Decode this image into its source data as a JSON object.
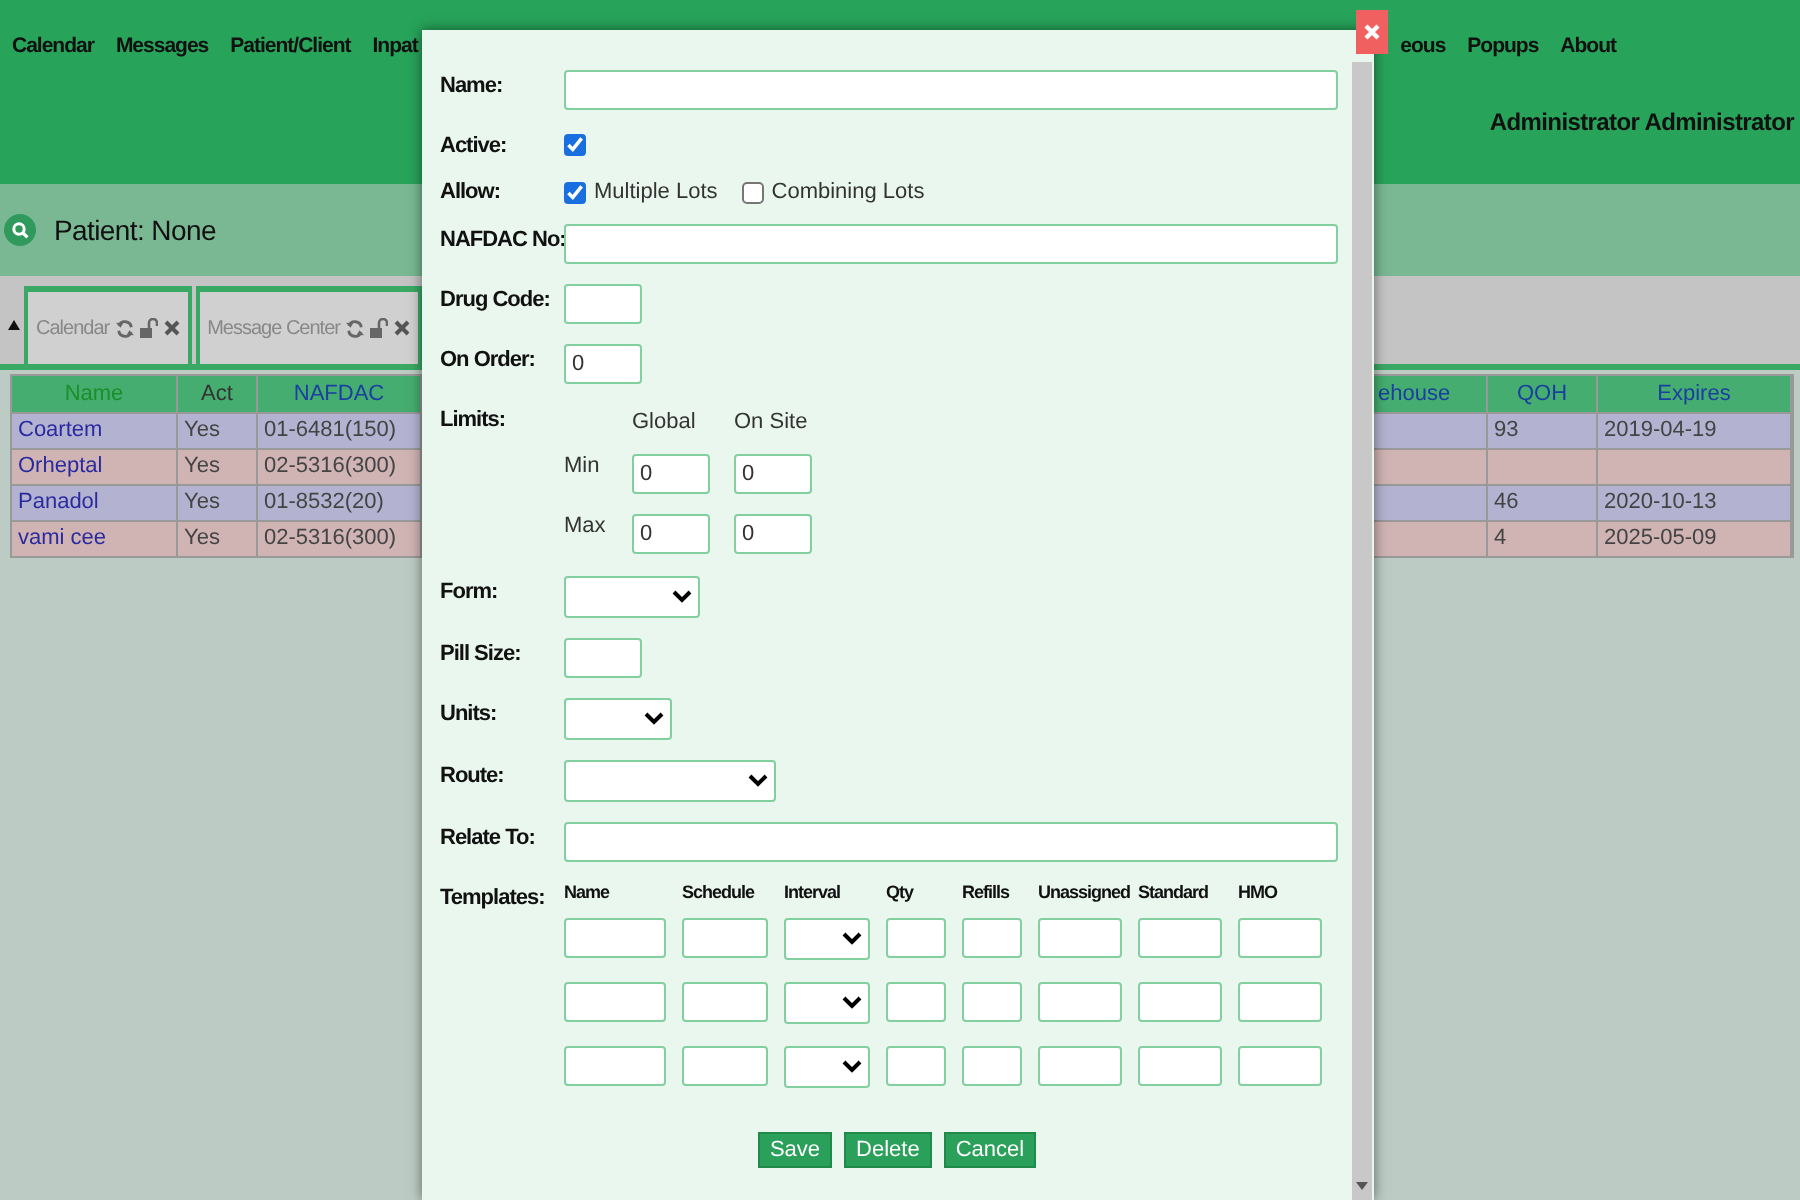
{
  "nav": {
    "left": [
      "Calendar",
      "Messages",
      "Patient/Client",
      "Inpat"
    ],
    "right": [
      "eous",
      "Popups",
      "About"
    ],
    "user": "Administrator Administrator"
  },
  "patient": "Patient: None",
  "tabs": [
    {
      "label": "Calendar"
    },
    {
      "label": "Message Center"
    }
  ],
  "table": {
    "columns": [
      "Name",
      "Act",
      "NAFDAC",
      "ehouse",
      "QOH",
      "Expires"
    ],
    "rows": [
      {
        "name": "Coartem",
        "act": "Yes",
        "nafdac": "01-6481(150)",
        "qoh": "93",
        "expires": "2019-04-19",
        "color": "#b3b3d1"
      },
      {
        "name": "Orheptal",
        "act": "Yes",
        "nafdac": "02-5316(300)",
        "color": "#d0b3b3"
      },
      {
        "name": "Panadol",
        "act": "Yes",
        "nafdac": "01-8532(20)",
        "qoh": "46",
        "expires": "2020-10-13",
        "color": "#b3b3d1"
      },
      {
        "name": "vami cee",
        "act": "Yes",
        "nafdac": "02-5316(300)",
        "qoh": "4",
        "expires": "2025-05-09",
        "color": "#d0b3b3"
      }
    ]
  },
  "modal": {
    "fields": [
      {
        "kind": "text",
        "label": "Name:"
      },
      {
        "kind": "checkbox",
        "label": "Active:",
        "checked": true
      },
      {
        "kind": "options",
        "label": "Allow:",
        "options": [
          {
            "label": "Multiple Lots",
            "checked": true
          },
          {
            "label": "Combining Lots",
            "checked": false
          }
        ]
      },
      {
        "kind": "text",
        "label": "NAFDAC No:"
      },
      {
        "kind": "text",
        "label": "Drug Code:"
      },
      {
        "kind": "text",
        "label": "On Order:",
        "value": "0"
      },
      {
        "kind": "limits",
        "label": "Limits:",
        "columns": [
          "Global",
          "On Site"
        ],
        "rows": [
          {
            "label": "Min",
            "values": [
              "0",
              "0"
            ]
          },
          {
            "label": "Max",
            "values": [
              "0",
              "0"
            ]
          }
        ]
      },
      {
        "kind": "select",
        "label": "Form:"
      },
      {
        "kind": "text",
        "label": "Pill Size:"
      },
      {
        "kind": "select",
        "label": "Units:"
      },
      {
        "kind": "select",
        "label": "Route:"
      },
      {
        "kind": "text",
        "label": "Relate To:"
      }
    ],
    "templates": {
      "label": "Templates:",
      "columns": [
        {
          "label": "Name",
          "kind": "text"
        },
        {
          "label": "Schedule",
          "kind": "text"
        },
        {
          "label": "Interval",
          "kind": "select"
        },
        {
          "label": "Qty",
          "kind": "text"
        },
        {
          "label": "Refills",
          "kind": "text"
        },
        {
          "label": "Unassigned",
          "kind": "text"
        },
        {
          "label": "Standard",
          "kind": "text"
        },
        {
          "label": "HMO",
          "kind": "text"
        }
      ]
    },
    "buttons": [
      "Save",
      "Delete",
      "Cancel"
    ]
  }
}
